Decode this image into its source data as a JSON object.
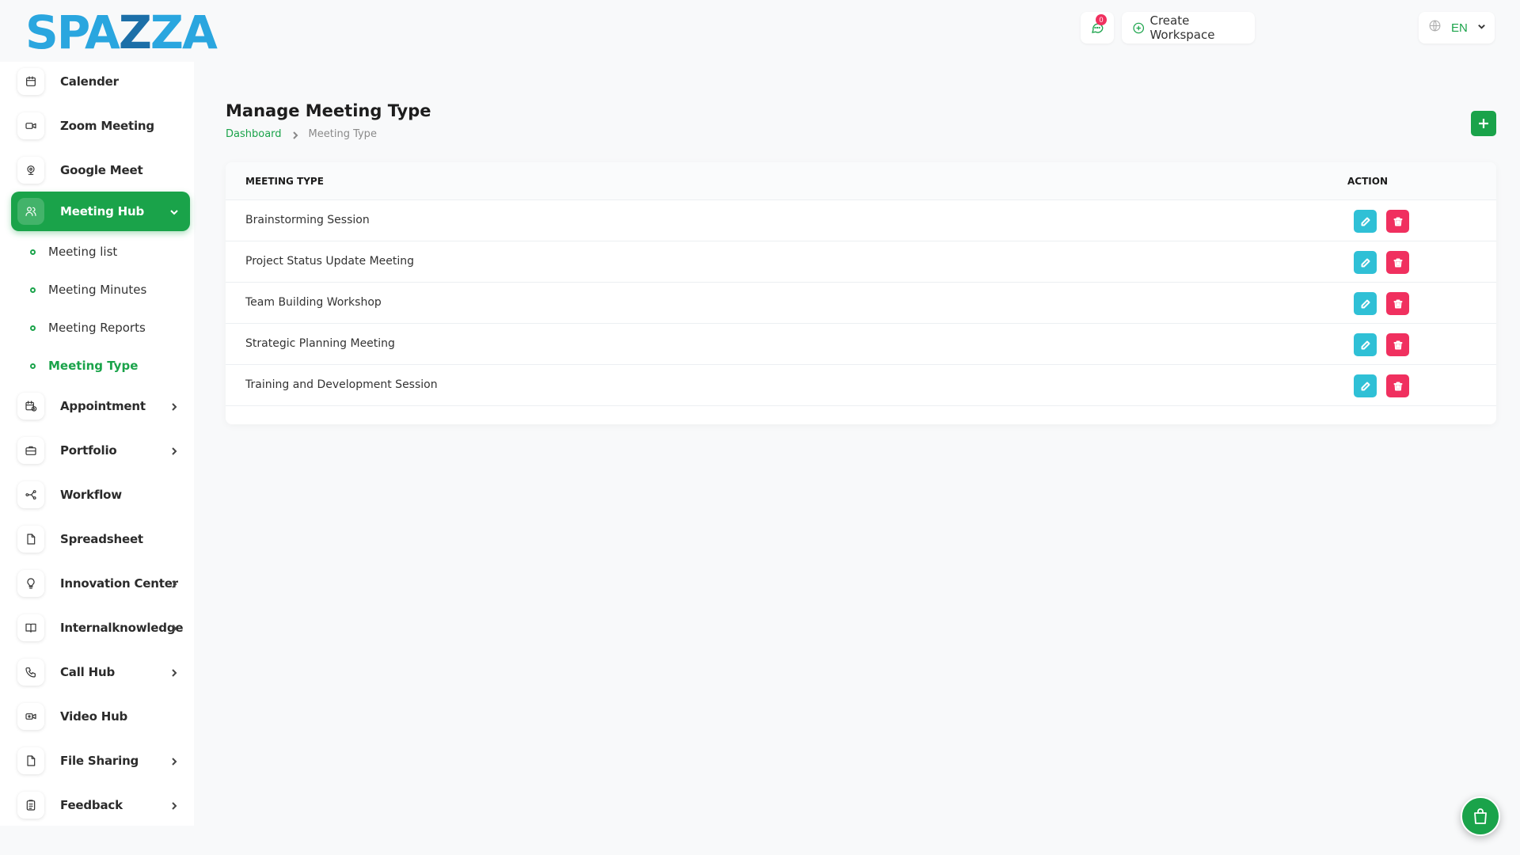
{
  "brand": {
    "logo_text_a": "SPA",
    "logo_text_z": "Z",
    "logo_text_b": "ZA",
    "color": "#2aa6df"
  },
  "topbar": {
    "notifications_count": "0",
    "create_workspace_label": "Create Workspace",
    "language": "EN"
  },
  "sidebar": {
    "items": [
      {
        "label": "Calender",
        "icon": "calendar-icon"
      },
      {
        "label": "Zoom Meeting",
        "icon": "video-camera-icon"
      },
      {
        "label": "Google Meet",
        "icon": "webcam-icon"
      },
      {
        "label": "Meeting Hub",
        "icon": "users-icon",
        "active": true,
        "expanded": true
      },
      {
        "label": "Appointment",
        "icon": "calendar-clock-icon",
        "has_children": true
      },
      {
        "label": "Portfolio",
        "icon": "briefcase-icon",
        "has_children": true
      },
      {
        "label": "Workflow",
        "icon": "workflow-icon"
      },
      {
        "label": "Spreadsheet",
        "icon": "file-icon"
      },
      {
        "label": "Innovation Center",
        "icon": "lightbulb-icon",
        "has_children": true
      },
      {
        "label": "Internalknowledge",
        "icon": "book-icon",
        "has_children": true
      },
      {
        "label": "Call Hub",
        "icon": "phone-icon",
        "has_children": true
      },
      {
        "label": "Video Hub",
        "icon": "video-icon"
      },
      {
        "label": "File Sharing",
        "icon": "file-icon",
        "has_children": true
      },
      {
        "label": "Feedback",
        "icon": "clipboard-icon",
        "has_children": true
      }
    ],
    "meeting_hub_children": [
      {
        "label": "Meeting list"
      },
      {
        "label": "Meeting Minutes"
      },
      {
        "label": "Meeting Reports"
      },
      {
        "label": "Meeting Type",
        "active": true
      }
    ]
  },
  "page": {
    "title": "Manage Meeting Type",
    "breadcrumb": {
      "home": "Dashboard",
      "current": "Meeting Type"
    }
  },
  "table": {
    "headers": {
      "type": "MEETING TYPE",
      "action": "ACTION"
    },
    "rows": [
      {
        "name": "Brainstorming Session"
      },
      {
        "name": "Project Status Update Meeting"
      },
      {
        "name": "Team Building Workshop"
      },
      {
        "name": "Strategic Planning Meeting"
      },
      {
        "name": "Training and Development Session"
      }
    ]
  },
  "colors": {
    "accent": "#1aa34a",
    "edit": "#2fc0d6",
    "delete": "#f0305f"
  }
}
